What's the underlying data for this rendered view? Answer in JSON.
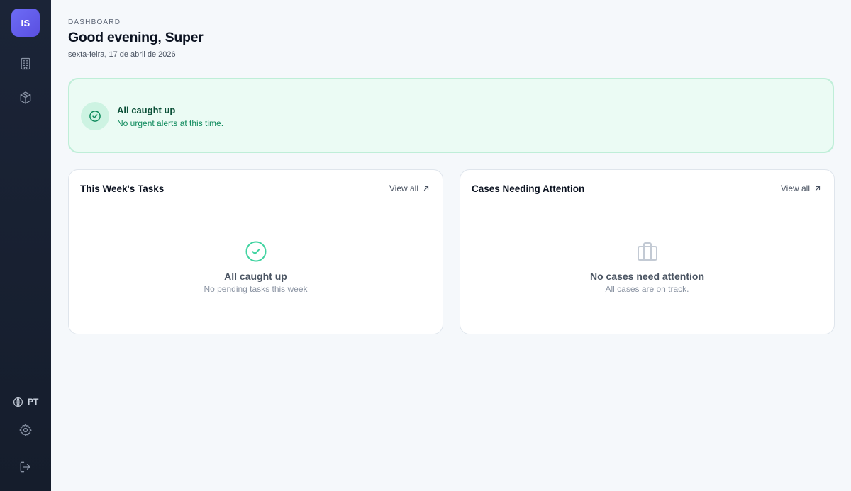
{
  "sidebar": {
    "logo_initials": "IS",
    "nav_icons": [
      "building-icon",
      "package-icon"
    ],
    "language_code": "PT",
    "bottom_icons": [
      "gear-icon",
      "logout-icon"
    ]
  },
  "header": {
    "kicker": "DASHBOARD",
    "title": "Good evening, Super",
    "date": "sexta-feira, 17 de abril de 2026"
  },
  "alert": {
    "title": "All caught up",
    "text": "No urgent alerts at this time.",
    "icon": "check-circle-icon",
    "accent_color": "#0e8a5c"
  },
  "cards": {
    "tasks": {
      "title": "This Week's Tasks",
      "view_all": "View all",
      "empty_title": "All caught up",
      "empty_text": "No pending tasks this week",
      "icon": "check-circle-icon"
    },
    "cases": {
      "title": "Cases Needing Attention",
      "view_all": "View all",
      "empty_title": "No cases need attention",
      "empty_text": "All cases are on track.",
      "icon": "briefcase-icon"
    }
  },
  "colors": {
    "sidebar_bg": "#1b2437",
    "brand": "#6366f1",
    "success": "#34d399"
  }
}
